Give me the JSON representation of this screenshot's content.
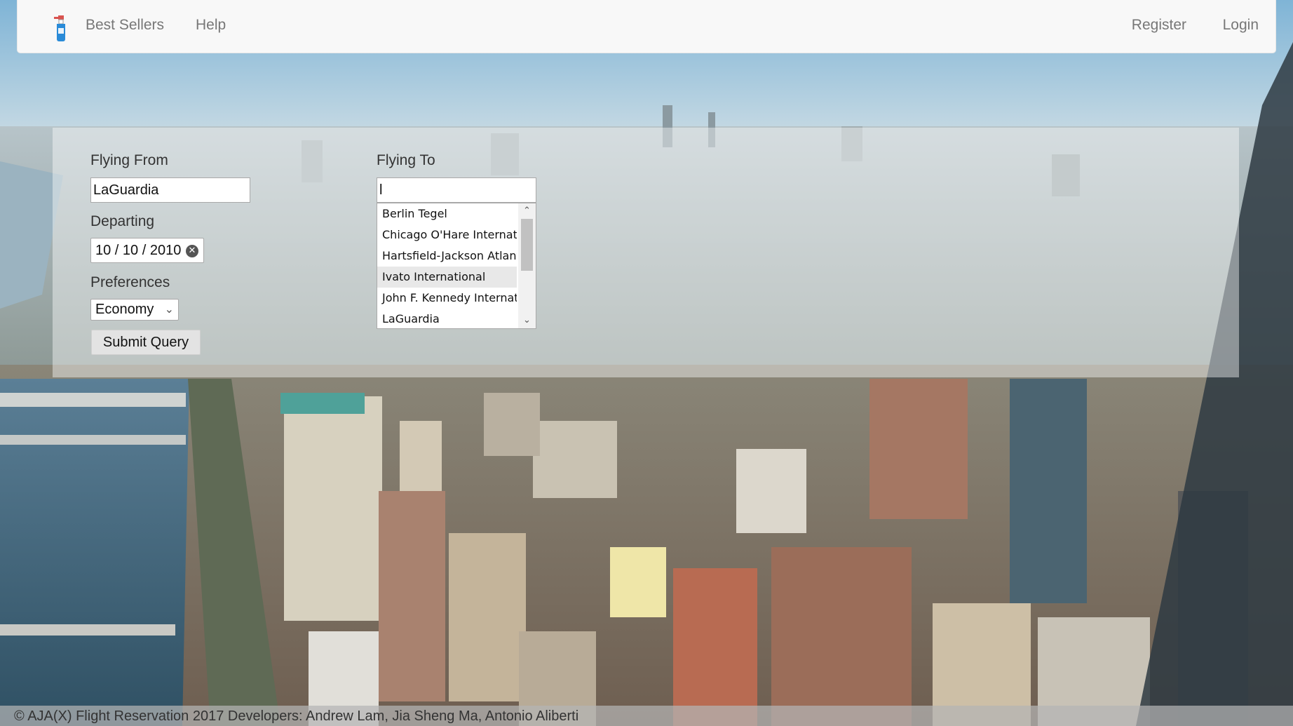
{
  "nav": {
    "logo_icon": "spray-bottle-icon",
    "best_sellers": "Best Sellers",
    "help": "Help",
    "register": "Register",
    "login": "Login"
  },
  "search": {
    "from_label": "Flying From",
    "from_value": "LaGuardia",
    "to_label": "Flying To",
    "to_value": "l",
    "departing_label": "Departing",
    "departing_value": "10 / 10 / 2010",
    "preferences_label": "Preferences",
    "preferences_value": "Economy",
    "submit_label": "Submit Query",
    "suggestions": [
      "Berlin Tegel",
      "Chicago O'Hare International",
      "Hartsfield-Jackson Atlanta International",
      "Ivato International",
      "John F. Kennedy International",
      "LaGuardia"
    ],
    "highlighted_suggestion": "Ivato International"
  },
  "footer": {
    "text": "© AJA(X) Flight Reservation 2017  Developers: Andrew Lam, Jia Sheng Ma, Antonio Aliberti"
  }
}
